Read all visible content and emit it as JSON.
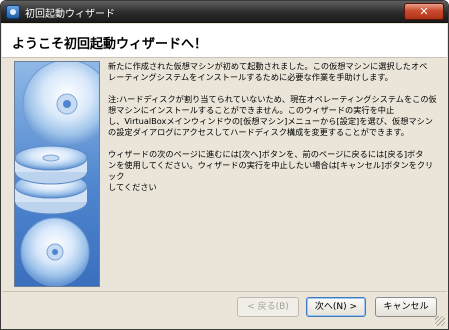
{
  "window": {
    "title": "初回起動ウィザード",
    "close_label": "✕"
  },
  "header": {
    "heading": "ようこそ初回起動ウィザードへ！"
  },
  "content": {
    "paragraph1": "新たに作成された仮想マシンが初めて起動されました。この仮想マシンに選択したオペ\nレーティングシステムをインストールするために必要な作業を手助けします。",
    "paragraph2": "注:ハードディスクが割り当てられていないため、現在オペレーティングシステムをこの仮\n想マシンにインストールすることができません。このウィザードの実行を中止\nし、VirtualBoxメインウィンドウの[仮想マシン]メニューから[設定]を選び、仮想マシン\nの設定ダイアログにアクセスしてハードディスク構成を変更することができます。",
    "paragraph3": "ウィザードの次のページに進むには[次へ]ボタンを、前のページに戻るには[戻る]ボタ\nンを使用してください。ウィザードの実行を中止したい場合は[キャンセル]ボタンをクリック\nしてください"
  },
  "buttons": {
    "back": "< 戻る(B)",
    "next": "次へ(N) >",
    "cancel": "キャンセル"
  },
  "icons": {
    "title_icon": "virtualbox-icon",
    "side_image": "cd-discs-icon"
  },
  "colors": {
    "title_bar": "#2c2c2c",
    "dialog_bg": "#eae5d8",
    "side_image_blue": "#4f86cf",
    "default_button_border": "#3d7bbd"
  }
}
